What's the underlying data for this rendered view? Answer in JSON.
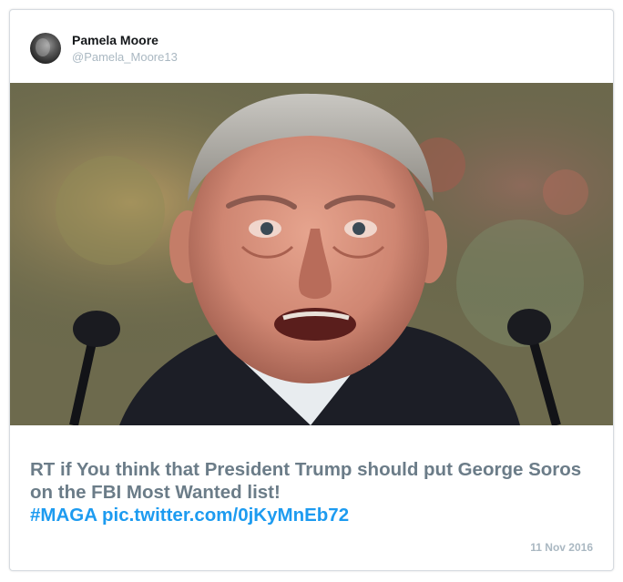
{
  "author": {
    "display_name": "Pamela Moore",
    "handle": "@Pamela_Moore13"
  },
  "tweet": {
    "text": "RT if You think that President Trump should put George Soros on the FBI Most Wanted list!",
    "hashtag": "#MAGA",
    "media_link": "pic.twitter.com/0jKyMnEb72",
    "date": "11 Nov 2016"
  },
  "colors": {
    "name": "#14171a",
    "secondary": "#aab8c2",
    "text": "#6b7c88",
    "link": "#1d9bf0"
  }
}
